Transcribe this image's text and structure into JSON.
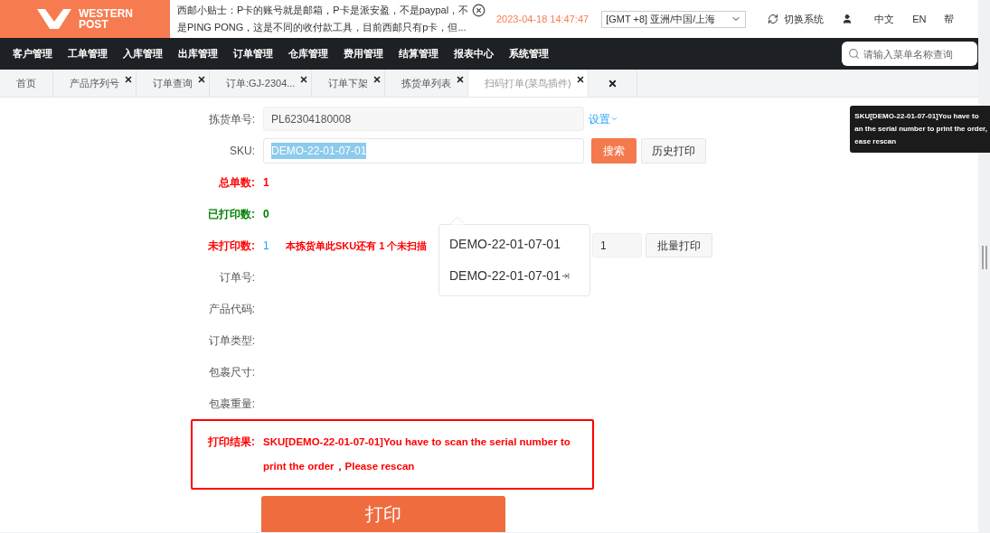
{
  "header": {
    "logo": {
      "line1": "WESTERN",
      "line2": "POST"
    },
    "notice": [
      "西邮小贴士：P卡的账号就是邮箱，P卡是派安盈，不是paypal，不",
      "是PING PONG，这是不同的收付款工具，目前西邮只有p卡，但..."
    ],
    "datetime": "2023-04-18 14:47:47",
    "timezone": "[GMT +8] 亚洲/中国/上海",
    "switch_system": "切换系统",
    "lang_items": [
      "中文",
      "EN",
      "帮"
    ]
  },
  "nav": {
    "items": [
      "客户管理",
      "工单管理",
      "入库管理",
      "出库管理",
      "订单管理",
      "仓库管理",
      "费用管理",
      "结算管理",
      "报表中心",
      "系统管理"
    ],
    "search_placeholder": "请输入菜单名称查询"
  },
  "tabs": [
    {
      "label": "首页",
      "closable": false,
      "selected": false
    },
    {
      "label": "产品序列号",
      "closable": true,
      "selected": false
    },
    {
      "label": "订单查询",
      "closable": true,
      "selected": false
    },
    {
      "label": "订单:GJ-2304...",
      "closable": true,
      "selected": false
    },
    {
      "label": "订单下架",
      "closable": true,
      "selected": false
    },
    {
      "label": "拣货单列表",
      "closable": true,
      "selected": false
    },
    {
      "label": "扫码打单(菜鸟插件)",
      "closable": true,
      "selected": true
    },
    {
      "closable": true,
      "selected": false
    }
  ],
  "form": {
    "pick_no": {
      "label": "拣货单号:",
      "value": "PL62304180008",
      "settings": "设置"
    },
    "sku": {
      "label": "SKU:",
      "value": "DEMO-22-01-07-01",
      "text_selected": true,
      "search_button": "搜索",
      "history_button": "历史打印"
    },
    "stats": [
      {
        "label": "总单数:",
        "value": "1",
        "kind": "alert"
      },
      {
        "label": "已打印数:",
        "value": "0",
        "kind": "ok"
      }
    ],
    "unprinted": {
      "label": "未打印数:",
      "value": "1",
      "note": "本拣货单此SKU还有 1 个未扫描",
      "quantity": "1",
      "batch_button": "批量打印"
    },
    "fields": [
      "订单号:",
      "产品代码:",
      "订单类型:",
      "包裹尺寸:",
      "包裹重量:"
    ],
    "result": {
      "label": "打印结果:",
      "message": "SKU[DEMO-22-01-07-01]You have to scan the serial number to print the order，Please rescan"
    },
    "print_button": "打印"
  },
  "autocomplete": [
    {
      "text": "DEMO-22-01-07-01",
      "kind": "plain"
    },
    {
      "text": "DEMO-22-01-07-01",
      "kind": "arrow"
    }
  ],
  "tooltip": [
    "SKU[DEMO-22-01-07-01]You have to",
    "an the serial number to print the order,",
    "ease rescan"
  ]
}
